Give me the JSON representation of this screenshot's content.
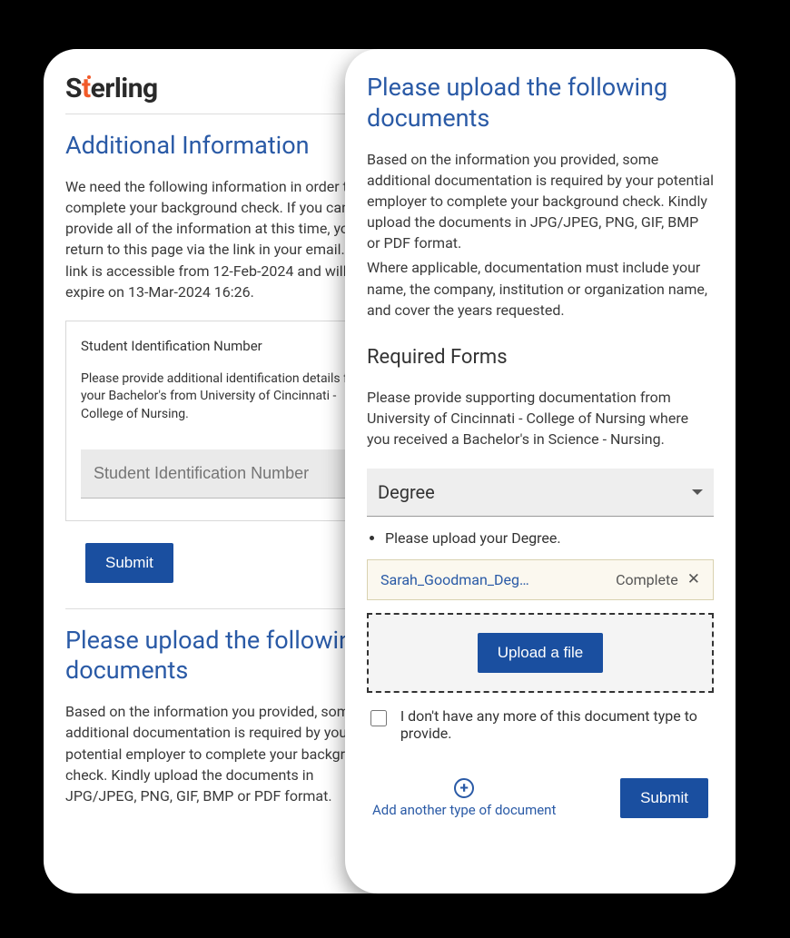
{
  "brand": {
    "name": "Sterling"
  },
  "left": {
    "heading": "Additional Information",
    "intro": "We need the following information in order to complete your background check. If you cannot provide all of the information at this time, you can return to this page via the link in your email. The link is accessible from 12-Feb-2024 and will expire on 13-Mar-2024 16:26.",
    "form": {
      "label": "Student Identification Number",
      "help": "Please provide additional identification details for your Bachelor's from University of Cincinnati - College of Nursing.",
      "placeholder": "Student Identification Number"
    },
    "submit_label": "Submit",
    "upload_heading": "Please upload the following documents",
    "upload_intro": "Based on the information you provided, some additional documentation is required by your potential employer to complete your background check. Kindly upload the documents in JPG/JPEG, PNG, GIF, BMP or PDF format."
  },
  "right": {
    "heading": "Please upload the following documents",
    "intro_line1": "Based on the information you provided, some additional documentation is required by your potential employer to complete your background check. Kindly upload the documents in JPG/JPEG, PNG, GIF, BMP or PDF format.",
    "intro_line2": "Where applicable, documentation must include your name, the company, institution or organization name, and cover the years requested.",
    "forms_heading": "Required Forms",
    "forms_help": "Please provide supporting documentation from University of Cincinnati - College of Nursing where you received a Bachelor's in Science - Nursing.",
    "select_label": "Degree",
    "bullet": "Please upload your Degree.",
    "file": {
      "name": "Sarah_Goodman_Deg…",
      "status": "Complete"
    },
    "upload_button": "Upload a file",
    "no_more_label": "I don't have any more of this document type to provide.",
    "add_label": "Add another type of document",
    "submit_label": "Submit"
  }
}
